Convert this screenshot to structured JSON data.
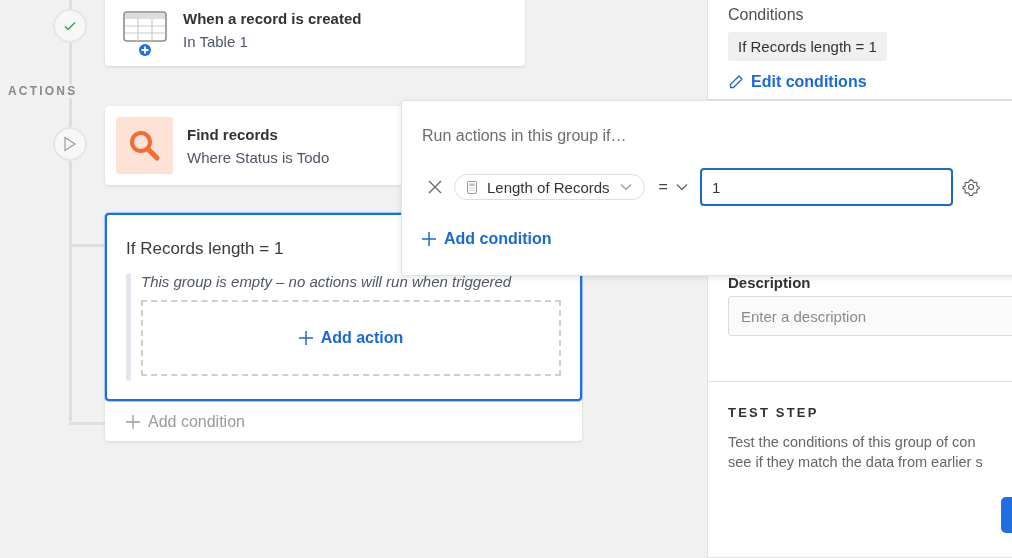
{
  "timeline": {
    "section_label": "ACTIONS"
  },
  "trigger": {
    "title": "When a record is created",
    "subtitle": "In Table 1",
    "done": true
  },
  "action": {
    "title": "Find records",
    "subtitle": "Where Status is Todo"
  },
  "group": {
    "title": "If Records length = 1",
    "selected": true,
    "empty_note": "This group is empty – no actions will run when triggered",
    "add_action": "Add action",
    "add_condition": "Add condition"
  },
  "popover": {
    "heading": "Run actions in this group if…",
    "field": "Length of Records",
    "operator": "=",
    "value": "1",
    "add_condition": "Add condition"
  },
  "panel": {
    "conditions_label": "Conditions",
    "condition_chip": "If Records length = 1",
    "edit_conditions": "Edit conditions",
    "description_label": "Description",
    "description_placeholder": "Enter a description",
    "test_heading": "TEST STEP",
    "test_text": [
      "Test the conditions of this group of con",
      "see if they match the data from earlier s"
    ]
  }
}
